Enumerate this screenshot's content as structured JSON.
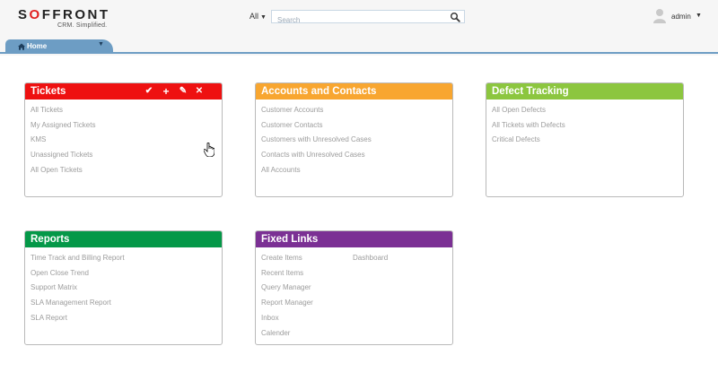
{
  "logo": {
    "text_a": "S",
    "text_o": "O",
    "text_b": "FFRONT",
    "tagline": "CRM. Simplified."
  },
  "search": {
    "scope": "All",
    "placeholder": "Search"
  },
  "user": {
    "name": "admin"
  },
  "tabs": [
    {
      "label": "Home"
    }
  ],
  "colors": {
    "tickets": "#ee1111",
    "accounts": "#f8a630",
    "defects": "#8cc63f",
    "reports": "#049848",
    "fixed": "#7b3094",
    "tab": "#6d9dc4"
  },
  "cards": {
    "tickets": {
      "title": "Tickets",
      "links": [
        "All Tickets",
        "My Assigned Tickets",
        "KMS",
        "Unassigned Tickets",
        "All Open Tickets"
      ]
    },
    "accounts": {
      "title": "Accounts and Contacts",
      "links": [
        "Customer Accounts",
        "Customer Contacts",
        "Customers with Unresolved Cases",
        "Contacts with Unresolved Cases",
        "All Accounts"
      ]
    },
    "defects": {
      "title": "Defect Tracking",
      "links": [
        "All Open Defects",
        "All Tickets with Defects",
        "Critical Defects"
      ]
    },
    "reports": {
      "title": "Reports",
      "links": [
        "Time Track and Billing Report",
        "Open Close Trend",
        "Support Matrix",
        "SLA Management Report",
        "SLA Report"
      ]
    },
    "fixed": {
      "title": "Fixed Links",
      "links": [
        "Create Items",
        "Recent Items",
        "Query Manager",
        "Report Manager",
        "Inbox",
        "Calender"
      ],
      "links_col2": [
        "Dashboard"
      ]
    }
  }
}
